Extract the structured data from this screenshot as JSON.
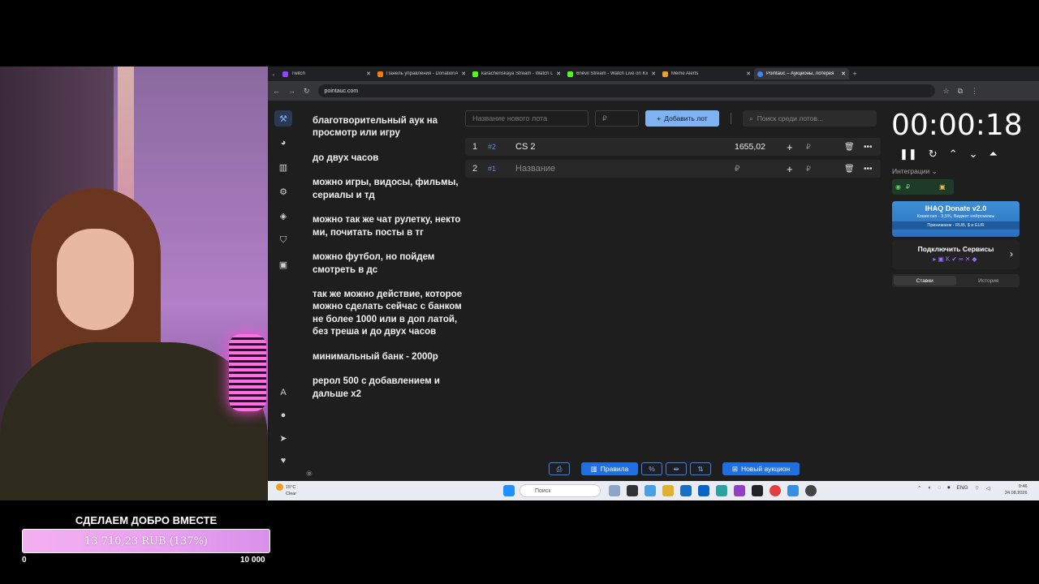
{
  "donation_goal": {
    "title": "СДЕЛАЕМ ДОБРО ВМЕСТЕ",
    "progress_text": "13 710,23 RUB (137%)",
    "min_label": "0",
    "max_label": "10 000",
    "progress_fraction": 1.0
  },
  "browser": {
    "tabs": [
      {
        "label": "Twitch",
        "color": "#9146ff"
      },
      {
        "label": "Панель управления - DonationAlerts",
        "color": "#f57d07"
      },
      {
        "label": "karachenskaya Stream - Watch Live",
        "color": "#53fc18"
      },
      {
        "label": "6nevil Stream - Watch Live on Kick",
        "color": "#53fc18"
      },
      {
        "label": "Meme Alerts",
        "color": "#f0a030"
      },
      {
        "label": "Pointauc – Аукционы, лотерея",
        "color": "#4285f4"
      }
    ],
    "url": "pointauc.com"
  },
  "rules": [
    "благотворительный аук на просмотр или игру",
    "до  двух часов",
    "можно игры, видосы, фильмы, сериалы и тд",
    "можно так же чат рулетку, некто ми, почитать посты в тг",
    "можно футбол, но пойдем смотреть в дс",
    "так же можно действие, которое можно сделать сейчас с банком не более 1000 или в доп латой, без треша  и до двух часов",
    "минимальный банк - 2000р",
    "рерол 500 с добавлением и дальше х2"
  ],
  "toolbar": {
    "lot_name_placeholder": "Название нового лота",
    "amount_placeholder": "₽",
    "add_lot_label": "Добавить лот",
    "search_placeholder": "Поиск среди лотов..."
  },
  "lots": [
    {
      "num": "1",
      "id": "#2",
      "name": "CS 2",
      "amount": "1655,02"
    },
    {
      "num": "2",
      "id": "#1",
      "name": "Название",
      "amount": ""
    }
  ],
  "currency": "₽",
  "timer": {
    "value": "00:00:18"
  },
  "integrations": {
    "label": "Интеграции",
    "banner_title": "IHAQ Donate v2.0",
    "banner_subtitle": "Комиссия - 3,5%, Виджет нейромемы",
    "banner_note": "Принимаем - RUB, $ и EUR",
    "connect_label": "Подключить Сервисы",
    "tab_bets": "Ставки",
    "tab_history": "История"
  },
  "bottom": {
    "rules_label": "Правила",
    "percent_label": "%",
    "new_auction_label": "Новый аукцион"
  },
  "taskbar": {
    "weather_temp": "15°C",
    "weather_desc": "Clear",
    "search_placeholder": "Поиск",
    "lang": "ENG",
    "time": "0:46",
    "date": "24.08.2026"
  }
}
